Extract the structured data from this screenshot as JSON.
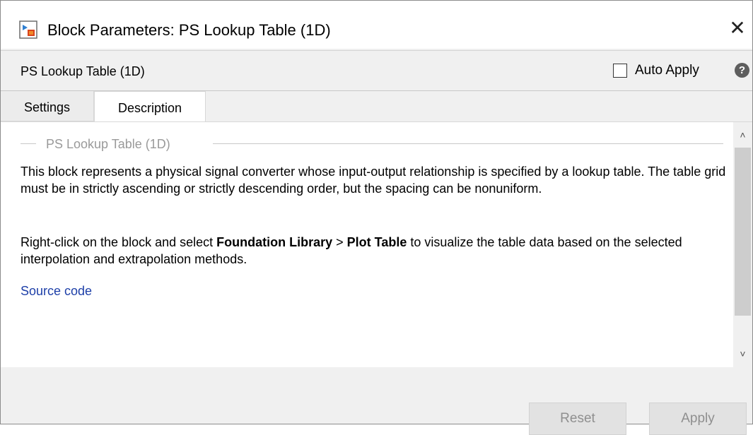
{
  "window": {
    "title": "Block Parameters: PS Lookup Table (1D)",
    "close_glyph": "✕"
  },
  "header": {
    "block_name": "PS Lookup Table (1D)",
    "auto_apply_label": "Auto Apply",
    "auto_apply_checked": false,
    "help_glyph": "?"
  },
  "tabs": [
    {
      "label": "Settings",
      "active": false
    },
    {
      "label": "Description",
      "active": true
    }
  ],
  "description": {
    "group_title": "PS Lookup Table (1D)",
    "paragraph1": "This block represents a physical signal converter whose input-output relationship is specified by a lookup table. The table grid must be in strictly ascending or strictly descending order, but the spacing can be nonuniform.",
    "paragraph2": {
      "prefix": "Right-click on the block and select ",
      "menu1": "Foundation Library",
      "separator": " > ",
      "menu2": "Plot Table",
      "suffix": " to visualize the table data based on the selected interpolation and extrapolation methods."
    },
    "source_link": "Source code"
  },
  "scrollbar": {
    "up_glyph": "˄",
    "down_glyph": "˅"
  },
  "footer": {
    "reset_label": "Reset",
    "apply_label": "Apply"
  },
  "icons": {
    "app": "simulink-block-icon",
    "help": "help-icon",
    "close": "close-icon"
  },
  "colors": {
    "link": "#1d3fa8",
    "disabled_text": "#8f8f8f",
    "group_title": "#9a9a9a"
  }
}
